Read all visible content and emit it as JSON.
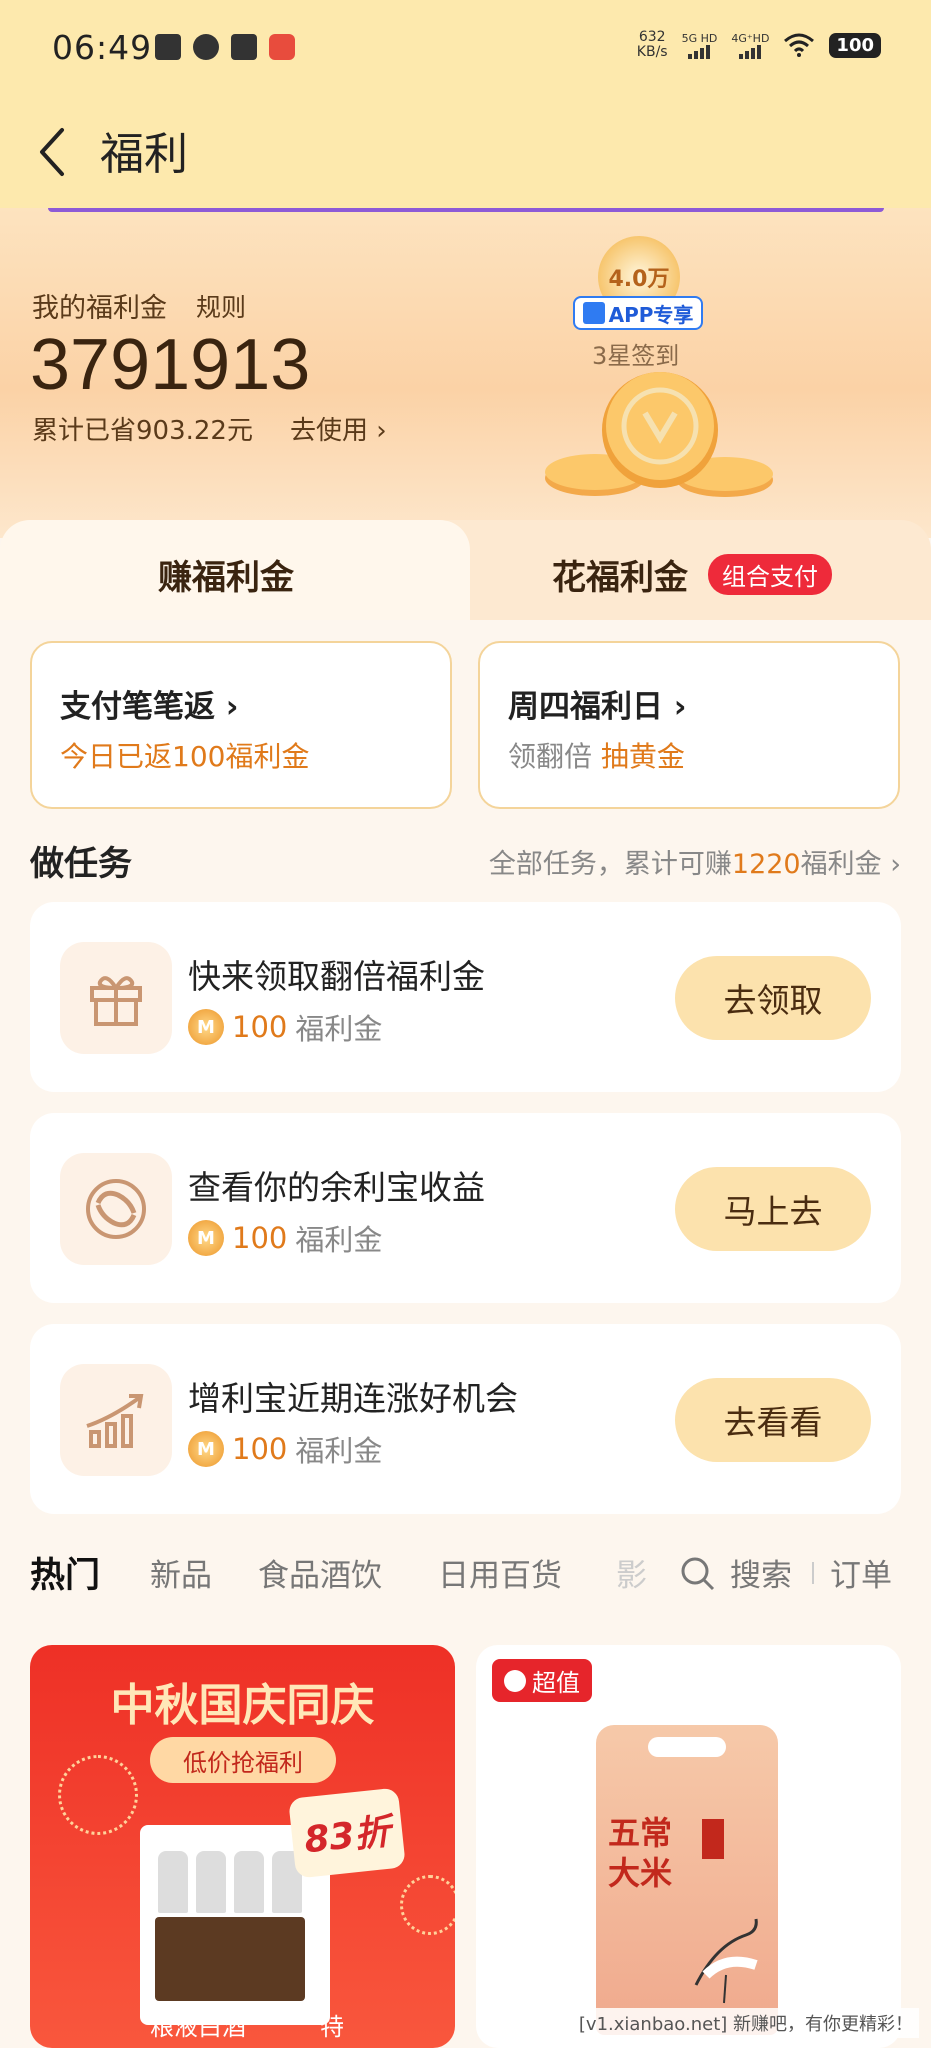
{
  "status_bar": {
    "time": "06:49",
    "net_speed_value": "632",
    "net_speed_unit": "KB/s",
    "signal1": "5G HD",
    "signal2": "4G⁺HD",
    "battery": "100"
  },
  "header": {
    "title": "福利"
  },
  "wallet": {
    "label": "我的福利金",
    "rule_link": "规则",
    "amount": "3791913",
    "saved_text": "累计已省903.22元",
    "use_link": "去使用 ›",
    "badge_value": "4.0万",
    "app_tag": "APP专享",
    "checkin_label": "3星签到"
  },
  "tabs": {
    "earn": "赚福利金",
    "spend": "花福利金",
    "spend_badge": "组合支付"
  },
  "promos": [
    {
      "title": "支付笔笔返 ›",
      "sub_highlight": "今日已返100福利金",
      "sub_gray": ""
    },
    {
      "title": "周四福利日 ›",
      "sub_gray": "领翻倍",
      "sub_highlight": "抽黄金"
    }
  ],
  "tasks_section": {
    "title": "做任务",
    "summary_pre": "全部任务，累计可赚",
    "summary_num": "1220",
    "summary_post": "福利金 ›"
  },
  "tasks": [
    {
      "title": "快来领取翻倍福利金",
      "reward_num": "100",
      "reward_unit": "福利金",
      "button": "去领取",
      "icon": "gift-icon"
    },
    {
      "title": "查看你的余利宝收益",
      "reward_num": "100",
      "reward_unit": "福利金",
      "button": "马上去",
      "icon": "yulibao-icon"
    },
    {
      "title": "增利宝近期连涨好机会",
      "reward_num": "100",
      "reward_unit": "福利金",
      "button": "去看看",
      "icon": "growth-chart-icon"
    }
  ],
  "categories": {
    "items": [
      "热门",
      "新品",
      "食品酒饮",
      "日用百货",
      "影"
    ],
    "search": "搜索",
    "orders": "订单"
  },
  "products": {
    "left": {
      "banner_title": "中秋国庆同庆",
      "banner_sub": "低价抢福利",
      "discount": "83折",
      "product_name": "粮液白酒",
      "product_name2": "特"
    },
    "right": {
      "tag": "超值",
      "bag_text": "五常大米"
    }
  },
  "watermark": "[v1.xianbao.net] 新赚吧，有你更精彩！",
  "colors": {
    "header_bg": "#fde9ad",
    "accent_orange": "#e07a1b",
    "badge_red": "#ee2a3a",
    "button_bg": "#fce2ad"
  }
}
